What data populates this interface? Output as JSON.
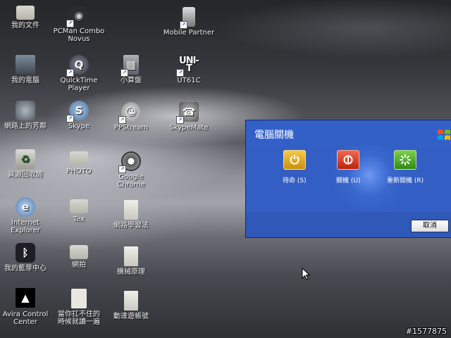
{
  "desktop_icons": {
    "my_documents": "我的文件",
    "my_computer": "我的電腦",
    "network_places": "網路上的芳鄰",
    "recycle_bin": "資源回收筒",
    "internet_explorer": "Internet\nExplorer",
    "bluetooth": "我的藍芽中心",
    "avira": "Avira Control\nCenter",
    "pcman": "PCMan Combo\nNovus",
    "quicktime": "QuickTime\nPlayer",
    "skype": "Skype",
    "photo": "PHOTO",
    "tex": "Tex",
    "paipai": "網拍",
    "wish_doc": "當你扛不住的\n時候就讀一遍",
    "calculator": "小算盤",
    "ppstream": "PPStream",
    "chrome": "Google\nChrome",
    "network_learn": "網路學習法",
    "mech_principle": "機械原理",
    "dongjie_account": "動達遊帳號",
    "mobile_partner": "Mobile Partner",
    "ut61c": "UT61C",
    "skypemate": "SkypeMate"
  },
  "dialog": {
    "title": "電腦關機",
    "standby_label": "待命 (S)",
    "shutdown_label": "關機 (U)",
    "restart_label": "重新開機 (R)",
    "cancel_label": "取消"
  },
  "watermark": "#1577875",
  "colors": {
    "dialog_blue": "#3360c6",
    "standby_yellow": "#e0a820",
    "shutdown_red": "#d8391e",
    "restart_green": "#4aa82a"
  }
}
